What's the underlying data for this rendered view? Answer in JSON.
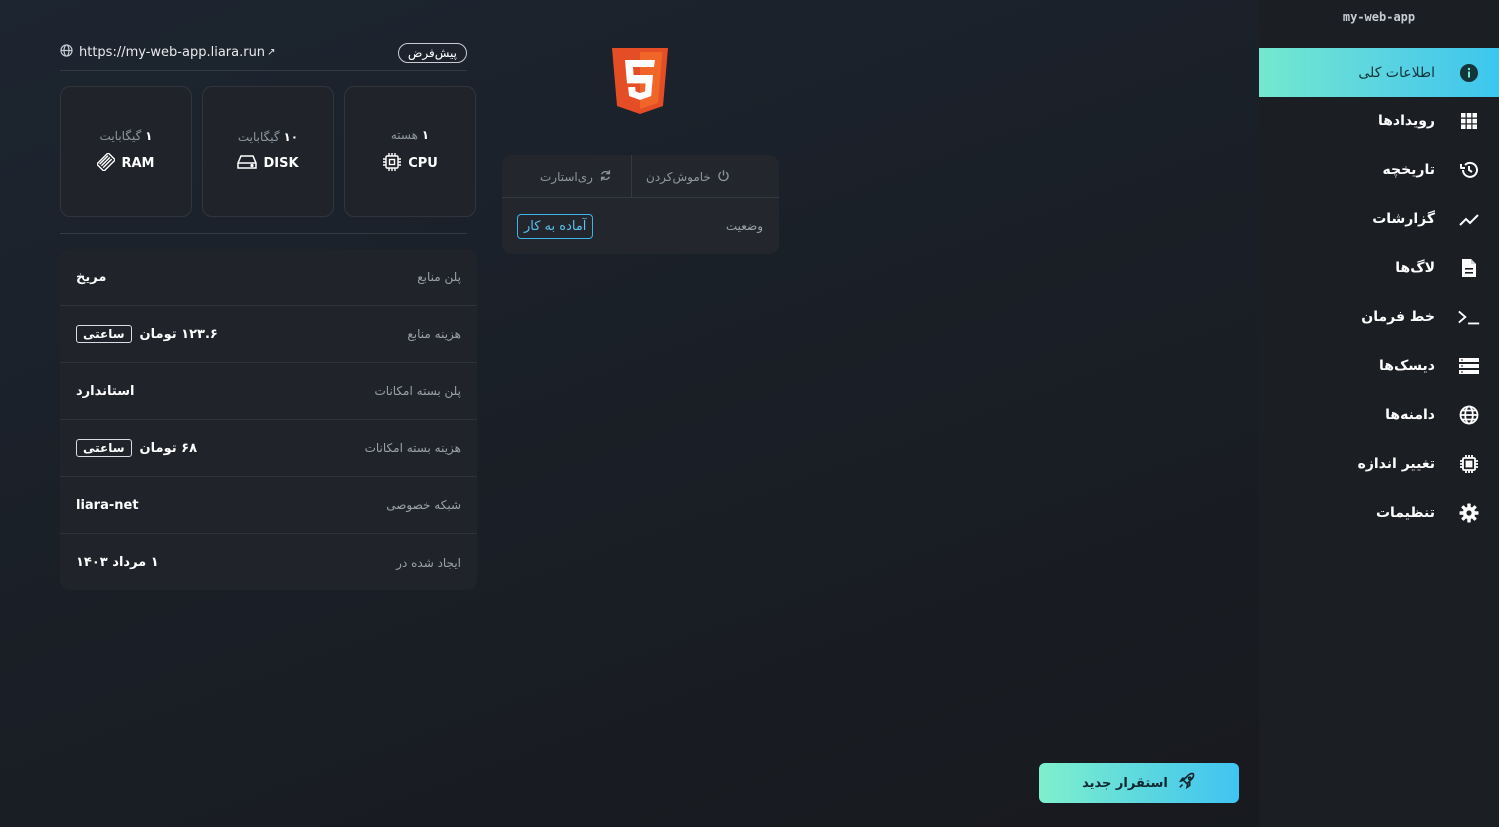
{
  "app": {
    "name": "my-web-app",
    "url": "https://my-web-app.liara.run",
    "badge": "پیش‌فرض"
  },
  "sidebar": {
    "items": [
      {
        "label": "اطلاعات کلی",
        "icon": "info-icon",
        "active": true
      },
      {
        "label": "رویدادها",
        "icon": "grid-icon"
      },
      {
        "label": "تاریخچه",
        "icon": "history-icon"
      },
      {
        "label": "گزارشات",
        "icon": "chart-line-icon"
      },
      {
        "label": "لاگ‌ها",
        "icon": "document-icon"
      },
      {
        "label": "خط فرمان",
        "icon": "terminal-icon"
      },
      {
        "label": "دیسک‌ها",
        "icon": "disk-list-icon"
      },
      {
        "label": "دامنه‌ها",
        "icon": "globe-icon"
      },
      {
        "label": "تغییر اندازه",
        "icon": "chip-icon"
      },
      {
        "label": "تنظیمات",
        "icon": "gear-icon"
      }
    ]
  },
  "specs": {
    "ram": {
      "label": "RAM",
      "value": "۱",
      "unit": " گیگابایت"
    },
    "disk": {
      "label": "DISK",
      "value": "۱۰",
      "unit": " گیگابایت"
    },
    "cpu": {
      "label": "CPU",
      "value": "۱",
      "unit": " هسته"
    }
  },
  "info": {
    "rows": [
      {
        "key": "پلن منابع",
        "value": "مریخ"
      },
      {
        "key": "هزینه منابع",
        "value": "۱۲۳.۶ تومان",
        "pill": "ساعتی"
      },
      {
        "key": "پلن بسته امکانات",
        "value": "استاندارد"
      },
      {
        "key": "هزینه بسته امکانات",
        "value": "۶۸ تومان",
        "pill": "ساعتی"
      },
      {
        "key": "شبکه خصوصی",
        "value": "liara-net"
      },
      {
        "key": "ایجاد شده در",
        "value": "۱ مرداد ۱۴۰۳"
      }
    ]
  },
  "status": {
    "power_off_label": "خاموش‌کردن",
    "restart_label": "ری‌استارت",
    "state_key": "وضعیت",
    "state_value": "آماده به کار"
  },
  "deploy": {
    "label": "استقرار جدید"
  },
  "colors": {
    "accent_start": "#74e8cf",
    "accent_end": "#3dc6ee",
    "status_blue": "#58c2f0",
    "html5_orange": "#e44d26"
  }
}
